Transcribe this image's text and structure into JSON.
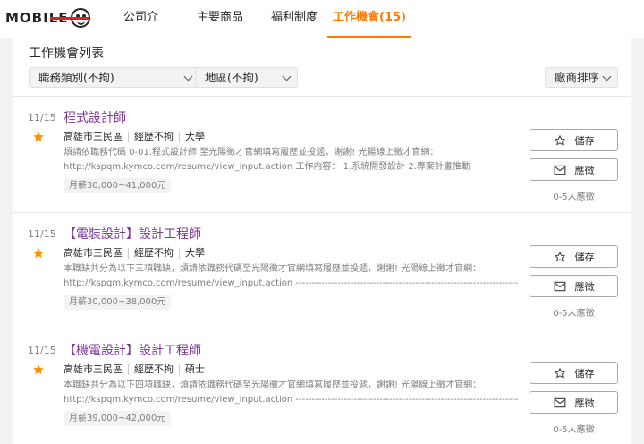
{
  "brand": {
    "logo_text": "MOBILE"
  },
  "nav": {
    "tabs": [
      {
        "label": "公司介紹"
      },
      {
        "label": "主要商品"
      },
      {
        "label": "福利制度"
      },
      {
        "label": "工作機會(15)",
        "active": true
      }
    ]
  },
  "list": {
    "title": "工作機會列表",
    "filters": {
      "category": "職務類別(不拘)",
      "area": "地區(不拘)",
      "sort": "廠商排序"
    }
  },
  "jobs": [
    {
      "date": "11/15",
      "title": "程式設計師",
      "location": "高雄市三民區",
      "experience": "經歷不拘",
      "education": "大學",
      "desc_line1": "煩請依職務代碼 0-01.程式設計師 至光陽徵才官網填寫履歷並投遞，謝謝! 光陽線上徵才官網：",
      "desc_line2": "http://kspqm.kymco.com/resume/view_input.action 工作內容： 1.系統開發設計 2.專案計畫推動",
      "salary": "月薪30,000~41,000元",
      "save_label": "儲存",
      "apply_label": "應徵",
      "applicants": "0-5人應徵"
    },
    {
      "date": "11/15",
      "title": "【電裝設計】設計工程師",
      "location": "高雄市三民區",
      "experience": "經歷不拘",
      "education": "大學",
      "desc_line1": "本職缺共分為以下三項職缺，煩請依職務代碼至光陽徵才官網填寫履歷並投遞，謝謝! 光陽線上徵才官網：",
      "desc_line2": "http://kspqm.kymco.com/resume/view_input.action -----------------------------------------------------------------------------...",
      "salary": "月薪30,000~38,000元",
      "save_label": "儲存",
      "apply_label": "應徵",
      "applicants": "0-5人應徵"
    },
    {
      "date": "11/15",
      "title": "【機電設計】設計工程師",
      "location": "高雄市三民區",
      "experience": "經歷不拘",
      "education": "碩士",
      "desc_line1": "本職缺共分為以下四項職缺，煩請依職務代碼至光陽徵才官網填寫履歷並投遞，謝謝! 光陽線上徵才官網：",
      "desc_line2": "http://kspqm.kymco.com/resume/view_input.action -----------------------------------------------------------------------------...",
      "salary": "月薪39,000~42,000元",
      "save_label": "儲存",
      "apply_label": "應徵",
      "applicants": "0-5人應徵"
    }
  ],
  "colors": {
    "accent": "#ff7800",
    "title_purple": "#7e3794",
    "star": "#ff9100",
    "text": "#292929",
    "muted": "#7e7e7e"
  },
  "icons": {
    "save": "star-outline-icon",
    "apply": "envelope-icon",
    "highlight": "star-filled-icon"
  }
}
